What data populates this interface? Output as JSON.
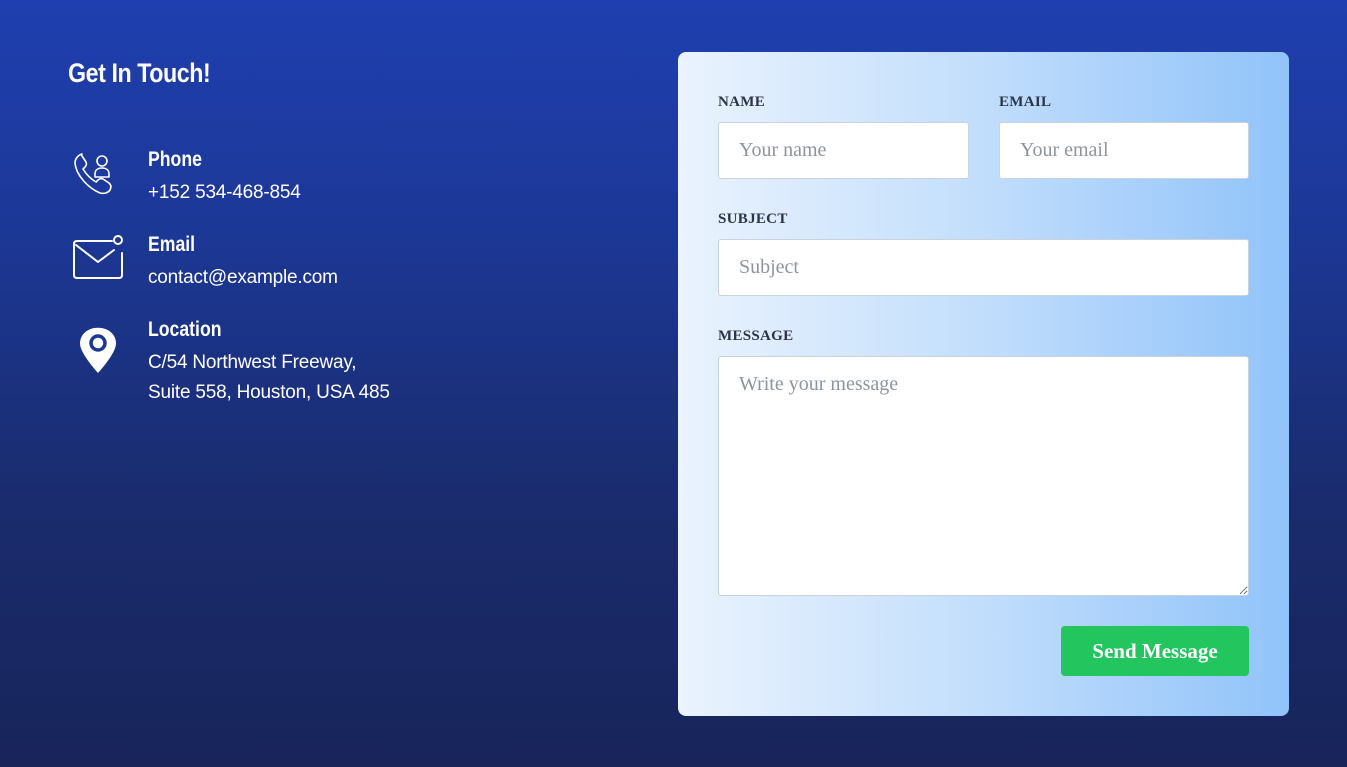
{
  "contact": {
    "heading": "Get In Touch!",
    "items": [
      {
        "label": "Phone",
        "lines": [
          "+152 534-468-854"
        ],
        "icon": "phone-icon"
      },
      {
        "label": "Email",
        "lines": [
          "contact@example.com"
        ],
        "icon": "mail-icon"
      },
      {
        "label": "Location",
        "lines": [
          "C/54 Northwest Freeway,",
          "Suite 558, Houston, USA 485"
        ],
        "icon": "location-pin-icon"
      }
    ]
  },
  "form": {
    "name": {
      "label": "NAME",
      "placeholder": "Your name",
      "value": ""
    },
    "email": {
      "label": "EMAIL",
      "placeholder": "Your email",
      "value": ""
    },
    "subject": {
      "label": "SUBJECT",
      "placeholder": "Subject",
      "value": ""
    },
    "message": {
      "label": "MESSAGE",
      "placeholder": "Write your message",
      "value": ""
    },
    "submit_label": "Send Message"
  },
  "colors": {
    "background_top": "#1f3fb0",
    "background_bottom": "#18245a",
    "card_gradient_start": "#eaf3fe",
    "card_gradient_end": "#91c3fa",
    "button": "#22c55e",
    "label_text": "#2b3346"
  }
}
